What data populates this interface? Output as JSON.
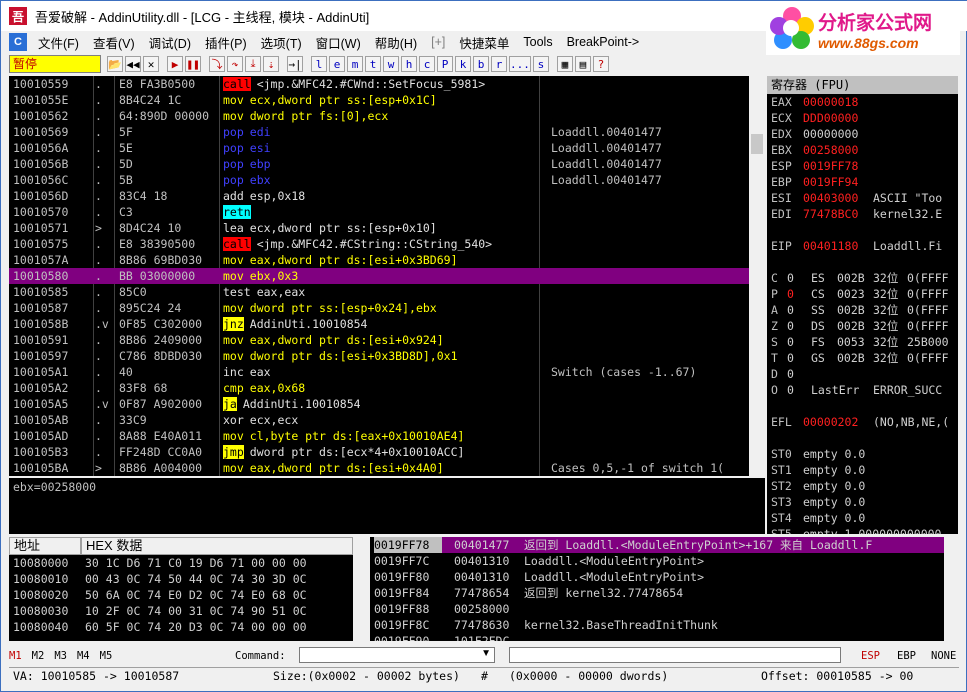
{
  "window": {
    "title": "吾爱破解 - AddinUtility.dll - [LCG - 主线程, 模块 - AddinUti]",
    "app_icon": "52pojie-icon",
    "logo": {
      "line1": "分析家公式网",
      "line2": "www.88gs.com"
    }
  },
  "menu": [
    "文件(F)",
    "查看(V)",
    "调试(D)",
    "插件(P)",
    "选项(T)",
    "窗口(W)",
    "帮助(H)",
    "[+]",
    "快捷菜单",
    "Tools",
    "BreakPoint->"
  ],
  "toolbar": {
    "status": "暂停",
    "letters": [
      "l",
      "e",
      "m",
      "t",
      "w",
      "h",
      "c",
      "P",
      "k",
      "b",
      "r",
      "...",
      "s"
    ]
  },
  "disasm": {
    "rows": [
      {
        "addr": "10010559",
        "mark": ".",
        "hex": "E8 FA3B0500",
        "op": "call",
        "opclass": "call",
        "args": "<jmp.&MFC42.#CWnd::SetFocus_5981>",
        "cmt": ""
      },
      {
        "addr": "1001055E",
        "mark": ".",
        "hex": "8B4C24 1C",
        "op": "mov",
        "opclass": "mov",
        "args": "ecx,dword ptr ss:[esp+0x1C]",
        "cmt": ""
      },
      {
        "addr": "10010562",
        "mark": ".",
        "hex": "64:890D 00000",
        "op": "mov",
        "opclass": "mov",
        "args": "dword ptr fs:[0],ecx",
        "cmt": ""
      },
      {
        "addr": "10010569",
        "mark": ".",
        "hex": "5F",
        "op": "pop",
        "opclass": "pop",
        "args": "edi",
        "cmt": "Loaddll.00401477"
      },
      {
        "addr": "1001056A",
        "mark": ".",
        "hex": "5E",
        "op": "pop",
        "opclass": "pop",
        "args": "esi",
        "cmt": "Loaddll.00401477"
      },
      {
        "addr": "1001056B",
        "mark": ".",
        "hex": "5D",
        "op": "pop",
        "opclass": "pop",
        "args": "ebp",
        "cmt": "Loaddll.00401477"
      },
      {
        "addr": "1001056C",
        "mark": ".",
        "hex": "5B",
        "op": "pop",
        "opclass": "pop",
        "args": "ebx",
        "cmt": "Loaddll.00401477"
      },
      {
        "addr": "1001056D",
        "mark": ".",
        "hex": "83C4 18",
        "op": "add",
        "opclass": "plain",
        "args": "esp,0x18",
        "cmt": ""
      },
      {
        "addr": "10010570",
        "mark": ".",
        "hex": "C3",
        "op": "retn",
        "opclass": "retn",
        "args": "",
        "cmt": ""
      },
      {
        "addr": "10010571",
        "mark": ">",
        "hex": "8D4C24 10",
        "op": "lea",
        "opclass": "plain",
        "args": "ecx,dword ptr ss:[esp+0x10]",
        "cmt": ""
      },
      {
        "addr": "10010575",
        "mark": ".",
        "hex": "E8 38390500",
        "op": "call",
        "opclass": "call",
        "args": "<jmp.&MFC42.#CString::CString_540>",
        "cmt": ""
      },
      {
        "addr": "1001057A",
        "mark": ".",
        "hex": "8B86 69BD030",
        "op": "mov",
        "opclass": "mov",
        "args": "eax,dword ptr ds:[esi+0x3BD69]",
        "cmt": ""
      },
      {
        "addr": "10010580",
        "mark": ".",
        "hex": "BB 03000000",
        "op": "mov",
        "opclass": "mov",
        "args": "ebx,0x3",
        "cmt": "",
        "selected": true
      },
      {
        "addr": "10010585",
        "mark": ".",
        "hex": "85C0",
        "op": "test",
        "opclass": "plain",
        "args": "eax,eax",
        "cmt": ""
      },
      {
        "addr": "10010587",
        "mark": ".",
        "hex": "895C24 24",
        "op": "mov",
        "opclass": "mov",
        "args": "dword ptr ss:[esp+0x24],ebx",
        "cmt": ""
      },
      {
        "addr": "1001058B",
        "mark": ".v",
        "hex": "0F85 C302000",
        "op": "jnz",
        "opclass": "jmp",
        "args": "AddinUti.10010854",
        "cmt": ""
      },
      {
        "addr": "10010591",
        "mark": ".",
        "hex": "8B86 2409000",
        "op": "mov",
        "opclass": "mov",
        "args": "eax,dword ptr ds:[esi+0x924]",
        "cmt": ""
      },
      {
        "addr": "10010597",
        "mark": ".",
        "hex": "C786 8DBD030",
        "op": "mov",
        "opclass": "mov",
        "args": "dword ptr ds:[esi+0x3BD8D],0x1",
        "cmt": ""
      },
      {
        "addr": "100105A1",
        "mark": ".",
        "hex": "40",
        "op": "inc",
        "opclass": "plain",
        "args": "eax",
        "cmt": "Switch (cases -1..67)"
      },
      {
        "addr": "100105A2",
        "mark": ".",
        "hex": "83F8 68",
        "op": "cmp",
        "opclass": "mov",
        "args": "eax,0x68",
        "cmt": ""
      },
      {
        "addr": "100105A5",
        "mark": ".v",
        "hex": "0F87 A902000",
        "op": "ja",
        "opclass": "jmp",
        "args": "AddinUti.10010854",
        "cmt": ""
      },
      {
        "addr": "100105AB",
        "mark": ".",
        "hex": "33C9",
        "op": "xor",
        "opclass": "plain",
        "args": "ecx,ecx",
        "cmt": ""
      },
      {
        "addr": "100105AD",
        "mark": ".",
        "hex": "8A88 E40A011",
        "op": "mov",
        "opclass": "mov",
        "args": "cl,byte ptr ds:[eax+0x10010AE4]",
        "cmt": ""
      },
      {
        "addr": "100105B3",
        "mark": ".",
        "hex": "FF248D CC0A0",
        "op": "jmp",
        "opclass": "jmp",
        "args": "dword ptr ds:[ecx*4+0x10010ACC]",
        "cmt": ""
      },
      {
        "addr": "100105BA",
        "mark": ">",
        "hex": "8B86 A004000",
        "op": "mov",
        "opclass": "mov",
        "args": "eax,dword ptr ds:[esi+0x4A0]",
        "cmt": "Cases 0,5,-1 of switch 1("
      }
    ],
    "info": "ebx=00258000"
  },
  "registers": {
    "title": "寄存器 (FPU)",
    "gp": [
      {
        "name": "EAX",
        "value": "00000018",
        "changed": true,
        "extra": ""
      },
      {
        "name": "ECX",
        "value": "DDD00000",
        "changed": true,
        "extra": ""
      },
      {
        "name": "EDX",
        "value": "00000000",
        "changed": false,
        "extra": ""
      },
      {
        "name": "EBX",
        "value": "00258000",
        "changed": true,
        "extra": ""
      },
      {
        "name": "ESP",
        "value": "0019FF78",
        "changed": true,
        "extra": ""
      },
      {
        "name": "EBP",
        "value": "0019FF94",
        "changed": true,
        "extra": ""
      },
      {
        "name": "ESI",
        "value": "00403000",
        "changed": true,
        "extra": "ASCII \"Too"
      },
      {
        "name": "EDI",
        "value": "77478BC0",
        "changed": true,
        "extra": "kernel32.E"
      }
    ],
    "eip": {
      "name": "EIP",
      "value": "00401180",
      "extra": "Loaddll.Fi"
    },
    "flags": [
      {
        "f": "C",
        "v": "0",
        "seg": "ES",
        "sv": "002B",
        "bits": "32位",
        "base": "0(FFFF"
      },
      {
        "f": "P",
        "v": "0",
        "seg": "CS",
        "sv": "0023",
        "bits": "32位",
        "base": "0(FFFF"
      },
      {
        "f": "A",
        "v": "0",
        "seg": "SS",
        "sv": "002B",
        "bits": "32位",
        "base": "0(FFFF"
      },
      {
        "f": "Z",
        "v": "0",
        "seg": "DS",
        "sv": "002B",
        "bits": "32位",
        "base": "0(FFFF"
      },
      {
        "f": "S",
        "v": "0",
        "seg": "FS",
        "sv": "0053",
        "bits": "32位",
        "base": "25B000"
      },
      {
        "f": "T",
        "v": "0",
        "seg": "GS",
        "sv": "002B",
        "bits": "32位",
        "base": "0(FFFF"
      },
      {
        "f": "D",
        "v": "0",
        "seg": "",
        "sv": "",
        "bits": "",
        "base": ""
      },
      {
        "f": "O",
        "v": "0",
        "seg": "LastErr",
        "sv": "",
        "bits": "",
        "base": "ERROR_SUCC"
      }
    ],
    "efl": {
      "name": "EFL",
      "value": "00000202",
      "extra": "(NO,NB,NE,("
    },
    "st": [
      {
        "name": "ST0",
        "value": "empty 0.0"
      },
      {
        "name": "ST1",
        "value": "empty 0.0"
      },
      {
        "name": "ST2",
        "value": "empty 0.0"
      },
      {
        "name": "ST3",
        "value": "empty 0.0"
      },
      {
        "name": "ST4",
        "value": "empty 0.0"
      },
      {
        "name": "ST5",
        "value": "empty 1.000000000000"
      },
      {
        "name": "ST6",
        "value": "empty 1.000000000000"
      }
    ]
  },
  "dump": {
    "col_addr": "地址",
    "col_hex": "HEX 数据",
    "rows": [
      {
        "addr": "10080000",
        "hex": "30 1C D6 71 C0 19 D6 71 00 00 00"
      },
      {
        "addr": "10080010",
        "hex": "00 43 0C 74 50 44 0C 74 30 3D 0C"
      },
      {
        "addr": "10080020",
        "hex": "50 6A 0C 74 E0 D2 0C 74 E0 68 0C"
      },
      {
        "addr": "10080030",
        "hex": "10 2F 0C 74 00 31 0C 74 90 51 0C"
      },
      {
        "addr": "10080040",
        "hex": "60 5F 0C 74 20 D3 0C 74 00 00 00"
      }
    ]
  },
  "stack": {
    "rows": [
      {
        "addr": "0019FF78",
        "val": "00401477",
        "cmt": "返回到 Loaddll.<ModuleEntryPoint>+167 来自 Loaddll.F",
        "sel": true
      },
      {
        "addr": "0019FF7C",
        "val": "00401310",
        "cmt": "Loaddll.<ModuleEntryPoint>",
        "sel": false
      },
      {
        "addr": "0019FF80",
        "val": "00401310",
        "cmt": "Loaddll.<ModuleEntryPoint>",
        "sel": false
      },
      {
        "addr": "0019FF84",
        "val": "77478654",
        "cmt": "返回到 kernel32.77478654",
        "sel": false
      },
      {
        "addr": "0019FF88",
        "val": "00258000",
        "cmt": "",
        "sel": false
      },
      {
        "addr": "0019FF8C",
        "val": "77478630",
        "cmt": "kernel32.BaseThreadInitThunk",
        "sel": false
      },
      {
        "addr": "0019FF90",
        "val": "101F2FDC",
        "cmt": "",
        "sel": false
      }
    ]
  },
  "cmdbar": {
    "markers": [
      "M1",
      "M2",
      "M3",
      "M4",
      "M5"
    ],
    "label": "Command:",
    "right": [
      "ESP",
      "EBP",
      "NONE"
    ]
  },
  "statusbar": {
    "va": "VA: 10010585 -> 10010587",
    "size": "Size:(0x0002 - 00002 bytes)",
    "hash": "#",
    "dwords": "(0x0000 - 00000 dwords)",
    "offset": "Offset: 00010585 -> 00"
  }
}
